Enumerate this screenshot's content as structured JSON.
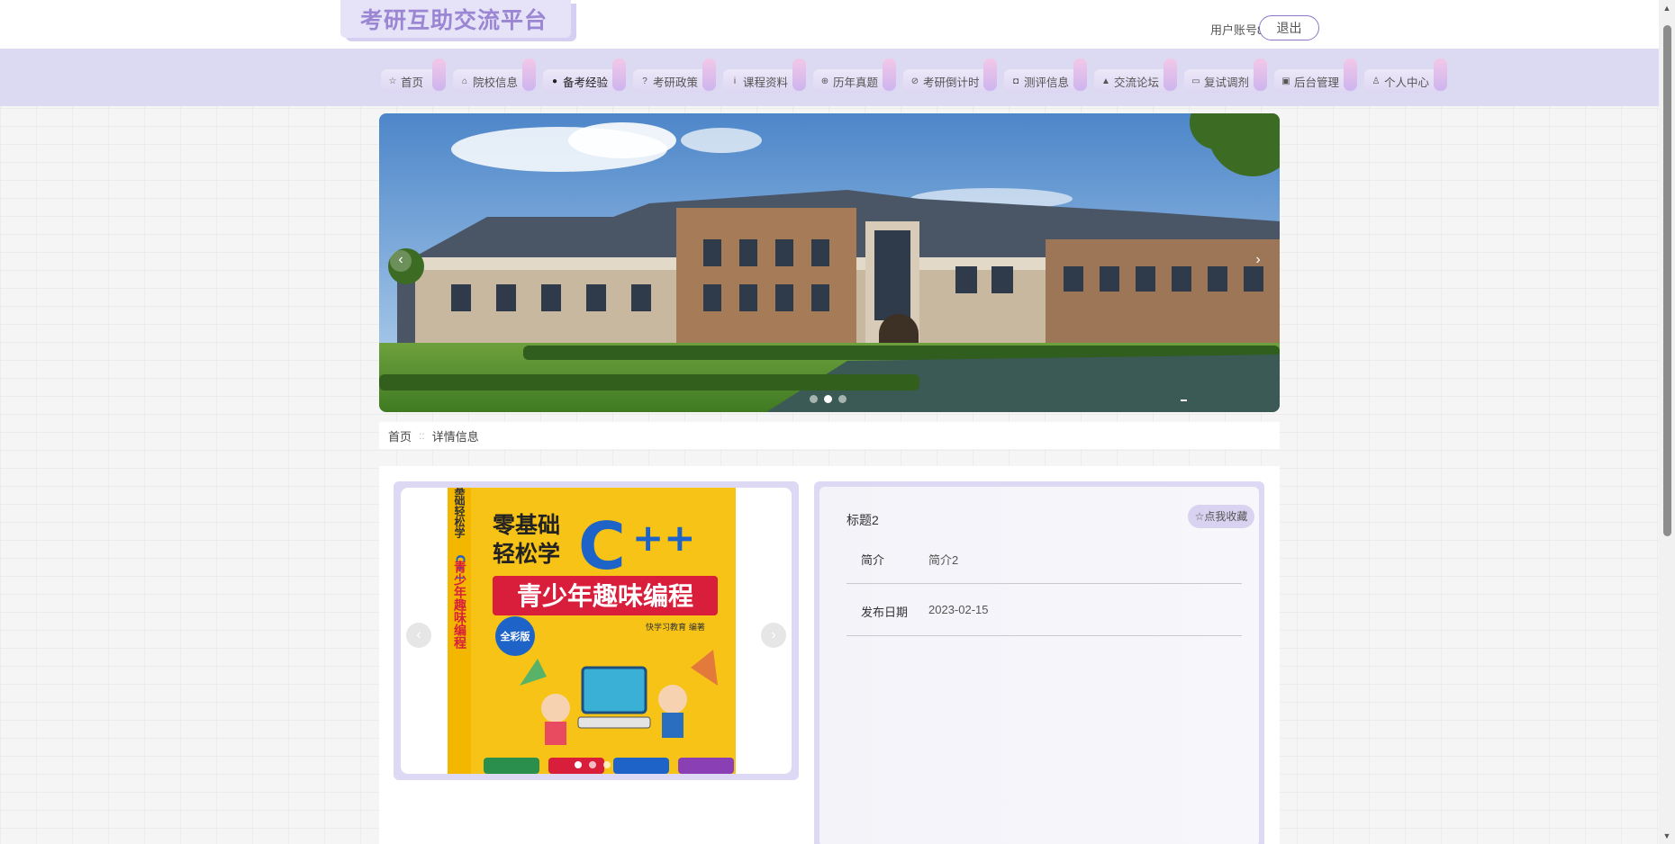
{
  "header": {
    "site_title": "考研互助交流平台",
    "account_label": "用户账号8",
    "logout_label": "退出"
  },
  "nav": {
    "items": [
      {
        "label": "首页",
        "icon": "home-icon",
        "glyph": "☆"
      },
      {
        "label": "院校信息",
        "icon": "school-icon",
        "glyph": "⌂"
      },
      {
        "label": "备考经验",
        "icon": "info-icon",
        "glyph": "●"
      },
      {
        "label": "考研政策",
        "icon": "question-icon",
        "glyph": "?"
      },
      {
        "label": "课程资料",
        "icon": "book-icon",
        "glyph": "i"
      },
      {
        "label": "历年真题",
        "icon": "paper-icon",
        "glyph": "⊕"
      },
      {
        "label": "考研倒计时",
        "icon": "clock-icon",
        "glyph": "⊘"
      },
      {
        "label": "测评信息",
        "icon": "camera-icon",
        "glyph": "◘"
      },
      {
        "label": "交流论坛",
        "icon": "forum-icon",
        "glyph": "▲"
      },
      {
        "label": "复试调剂",
        "icon": "video-icon",
        "glyph": "▭"
      },
      {
        "label": "后台管理",
        "icon": "admin-icon",
        "glyph": "▣"
      },
      {
        "label": "个人中心",
        "icon": "user-icon",
        "glyph": "♙"
      }
    ],
    "active_index": 2
  },
  "carousel": {
    "image": "campus-building-photo",
    "active_slide": 2,
    "slide_count": 3
  },
  "breadcrumb": {
    "home": "首页",
    "separator": "::",
    "current": "详情信息"
  },
  "detail": {
    "title": "标题2",
    "favorite_label": "☆点我收藏",
    "fields": [
      {
        "key": "简介",
        "value": "简介2"
      },
      {
        "key": "发布日期",
        "value": "2023-02-15"
      }
    ],
    "gallery": {
      "image": "cpp-book-cover",
      "slide_count": 3,
      "active_slide": 1
    }
  },
  "colors": {
    "accent": "#9b86d4",
    "nav_bg": "#dcdaf2",
    "frame": "#ddd8f3"
  }
}
